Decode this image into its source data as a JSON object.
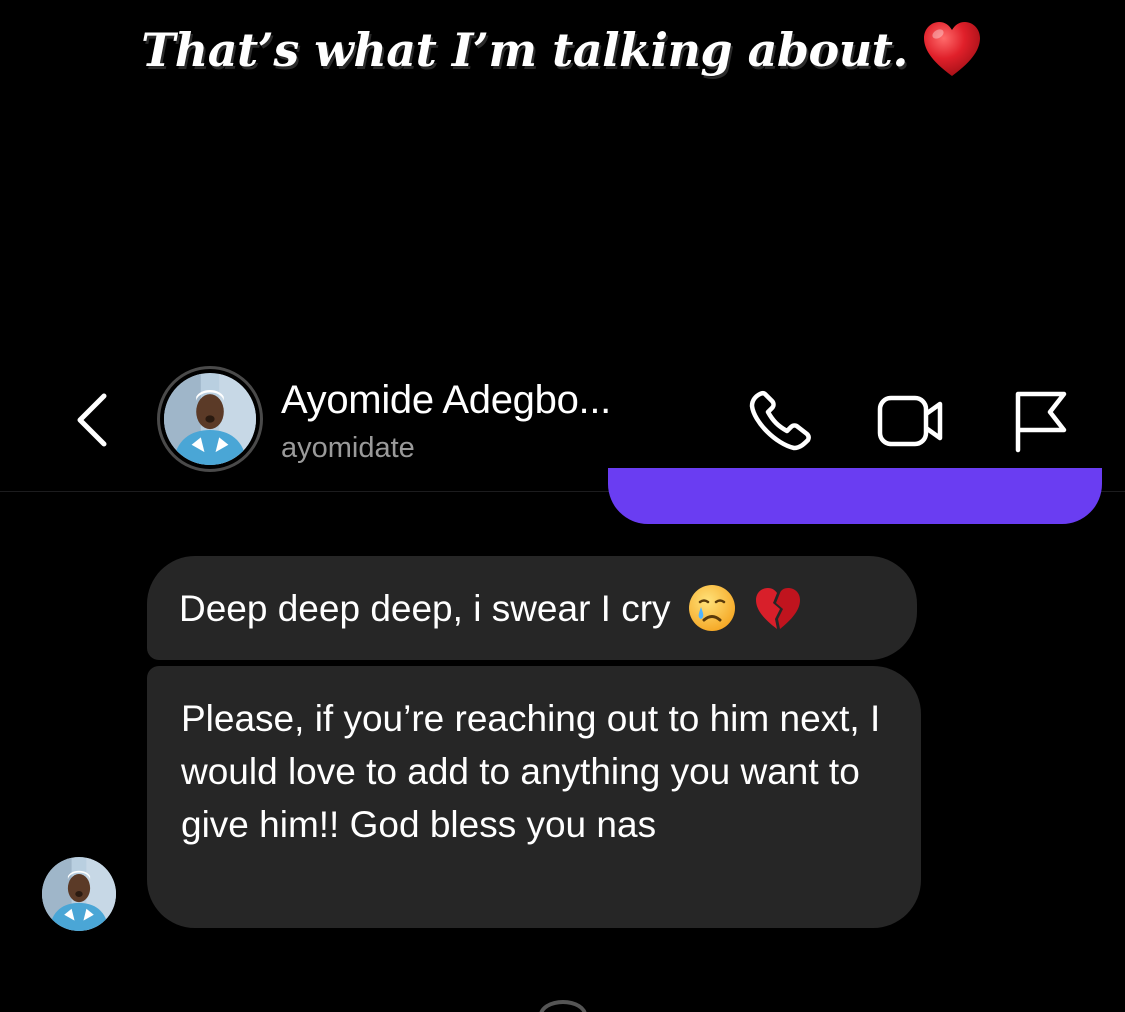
{
  "story": {
    "caption": "That’s what I’m talking about.",
    "caption_emoji": "red-heart-icon"
  },
  "header": {
    "contact_name": "Ayomide Adegbo...",
    "contact_handle": "ayomidate",
    "icons": [
      "back-icon",
      "avatar",
      "phone-icon",
      "video-camera-icon",
      "flag-icon"
    ]
  },
  "thread": {
    "sent_bubble_color": "#6a3df2",
    "received_bubble_color": "#262626",
    "messages": [
      {
        "sender": "received",
        "text": "Deep deep deep, i swear I cry",
        "emojis": [
          "crying-face-icon",
          "broken-heart-icon"
        ]
      },
      {
        "sender": "received",
        "text": "Please, if you’re reaching out to him next, I would love to add to anything you want to give him!! God bless you nas"
      }
    ]
  },
  "colors": {
    "background": "#000000",
    "text": "#ffffff",
    "secondary_text": "#9a9a9a",
    "accent_purple": "#6a3df2",
    "heart_red": "#e0202a"
  }
}
